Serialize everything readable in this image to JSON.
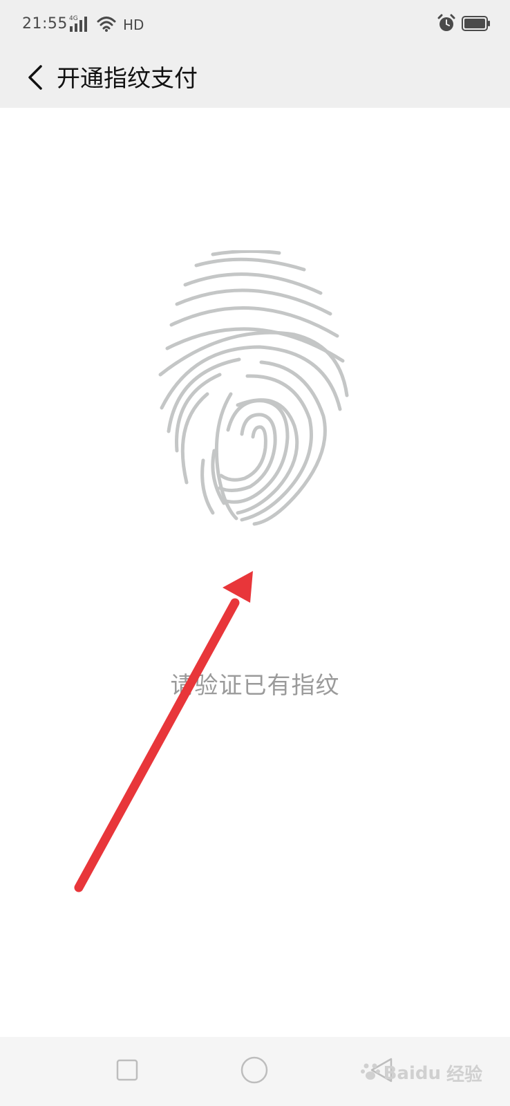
{
  "status_bar": {
    "time": "21:55",
    "network_type": "4G",
    "hd_label": "HD",
    "icons": [
      "signal-icon",
      "wifi-icon",
      "alarm-icon",
      "battery-icon"
    ]
  },
  "header": {
    "title": "开通指纹支付",
    "back_icon": "back-chevron-icon"
  },
  "main": {
    "fingerprint_icon": "fingerprint-icon",
    "hint": "请验证已有指纹"
  },
  "nav_bar": {
    "items": [
      "recent-apps-button",
      "home-button",
      "back-button"
    ]
  },
  "watermark": {
    "brand": "Baidu",
    "brand_suffix": "经验"
  },
  "colors": {
    "bar_background": "#efefef",
    "fingerprint": "#c4c6c6",
    "hint_text": "#9a9a9a",
    "arrow": "#e8363a"
  }
}
